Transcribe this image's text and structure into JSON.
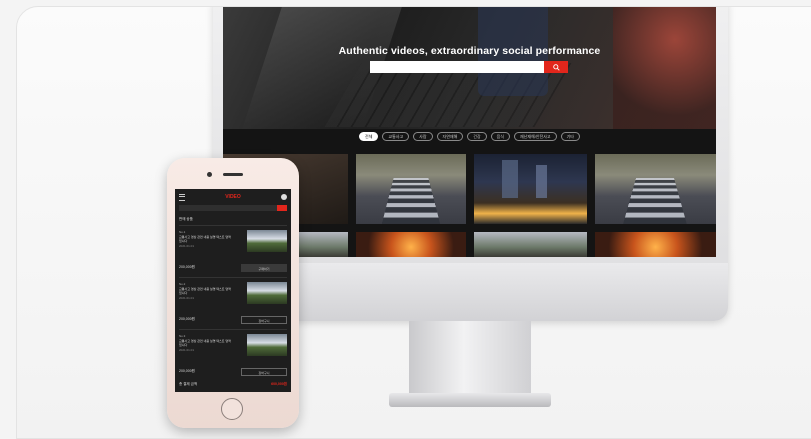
{
  "desktop": {
    "hero_title": "Authentic videos, extraordinary social performance",
    "search_placeholder": "",
    "categories": [
      {
        "label": "전체",
        "active": true
      },
      {
        "label": "교통사고",
        "active": false
      },
      {
        "label": "사람",
        "active": false
      },
      {
        "label": "자연재해",
        "active": false
      },
      {
        "label": "건강",
        "active": false
      },
      {
        "label": "음식",
        "active": false
      },
      {
        "label": "재난재해/안전사고",
        "active": false
      },
      {
        "label": "기타",
        "active": false
      }
    ]
  },
  "mobile": {
    "logo": "VIDEO",
    "section_title": "판매 상품",
    "items": [
      {
        "num": "No.1",
        "desc": "교통사고 영상 관련 내용 설명 텍스트 영역 입니다",
        "date": "2021.01.01",
        "price": "200,000원",
        "button": "구매하기"
      },
      {
        "num": "No.2",
        "desc": "교통사고 영상 관련 내용 설명 텍스트 영역 입니다",
        "date": "2021.01.01",
        "price": "200,000원",
        "button": "장바구니"
      },
      {
        "num": "No.3",
        "desc": "교통사고 영상 관련 내용 설명 텍스트 영역 입니다",
        "date": "2021.01.01",
        "price": "200,000원",
        "button": "장바구니"
      }
    ],
    "total_label": "총 결제 금액",
    "total_value": "600,000원"
  },
  "colors": {
    "accent": "#e2261c",
    "screen_bg": "#141414"
  }
}
